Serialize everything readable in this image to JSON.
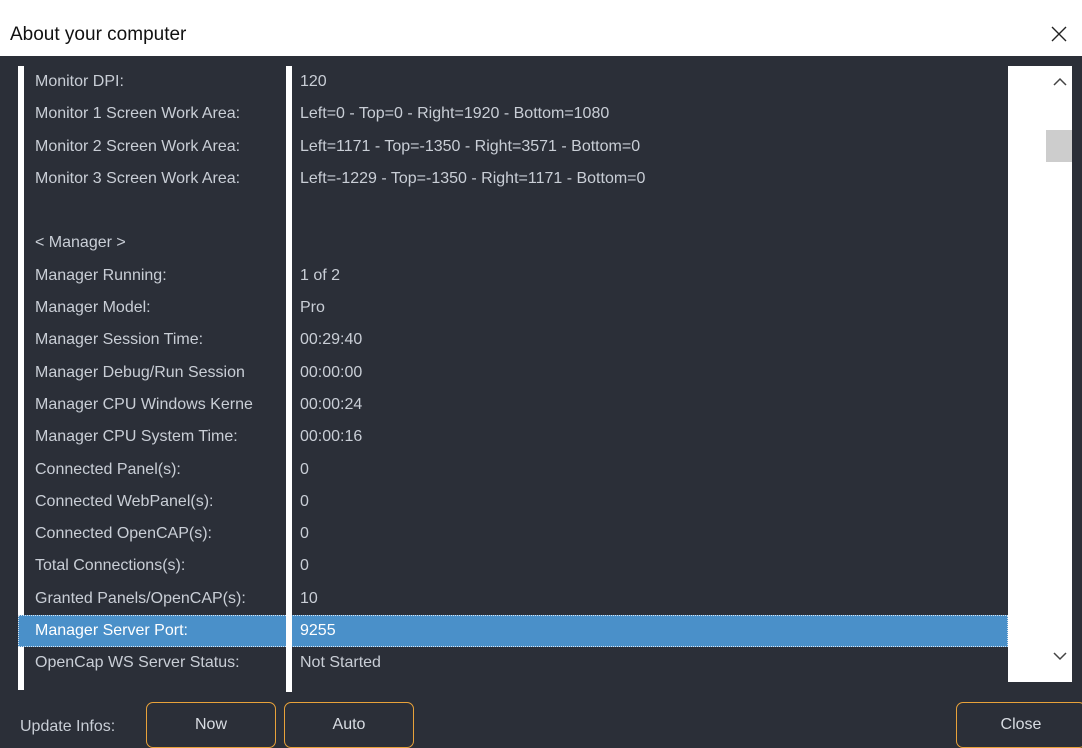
{
  "window": {
    "title": "About your computer"
  },
  "rows": [
    {
      "key": "Monitor DPI:",
      "value": "120"
    },
    {
      "key": "Monitor 1 Screen Work Area:",
      "value": "Left=0 - Top=0 - Right=1920 - Bottom=1080"
    },
    {
      "key": "Monitor 2 Screen Work Area:",
      "value": "Left=1171 - Top=-1350 - Right=3571 - Bottom=0"
    },
    {
      "key": "Monitor 3 Screen Work Area:",
      "value": "Left=-1229 - Top=-1350 - Right=1171 - Bottom=0"
    },
    {
      "key": "",
      "value": ""
    },
    {
      "key": "< Manager >",
      "value": ""
    },
    {
      "key": "Manager Running:",
      "value": "1 of 2"
    },
    {
      "key": "Manager Model:",
      "value": "Pro"
    },
    {
      "key": "Manager Session Time:",
      "value": "00:29:40"
    },
    {
      "key": "Manager Debug/Run Session",
      "value": "00:00:00"
    },
    {
      "key": "Manager CPU Windows Kerne",
      "value": "00:00:24"
    },
    {
      "key": "Manager CPU System Time:",
      "value": "00:00:16"
    },
    {
      "key": "Connected Panel(s):",
      "value": "0"
    },
    {
      "key": "Connected WebPanel(s):",
      "value": "0"
    },
    {
      "key": "Connected OpenCAP(s):",
      "value": "0"
    },
    {
      "key": "Total Connections(s):",
      "value": "0"
    },
    {
      "key": "Granted Panels/OpenCAP(s):",
      "value": "10"
    },
    {
      "key": "Manager Server Port:",
      "value": "9255",
      "selected": true
    },
    {
      "key": "OpenCap WS Server Status:",
      "value": "Not Started"
    }
  ],
  "footer": {
    "update_label": "Update Infos:",
    "now_label": "Now",
    "auto_label": "Auto",
    "close_label": "Close"
  },
  "icons": {
    "close": "close-icon",
    "scroll_up": "chevron-up-icon",
    "scroll_down": "chevron-down-icon"
  },
  "colors": {
    "background": "#2b2f38",
    "text": "#c9ced6",
    "selection": "#4a90c9",
    "button_border": "#e8a23a"
  }
}
